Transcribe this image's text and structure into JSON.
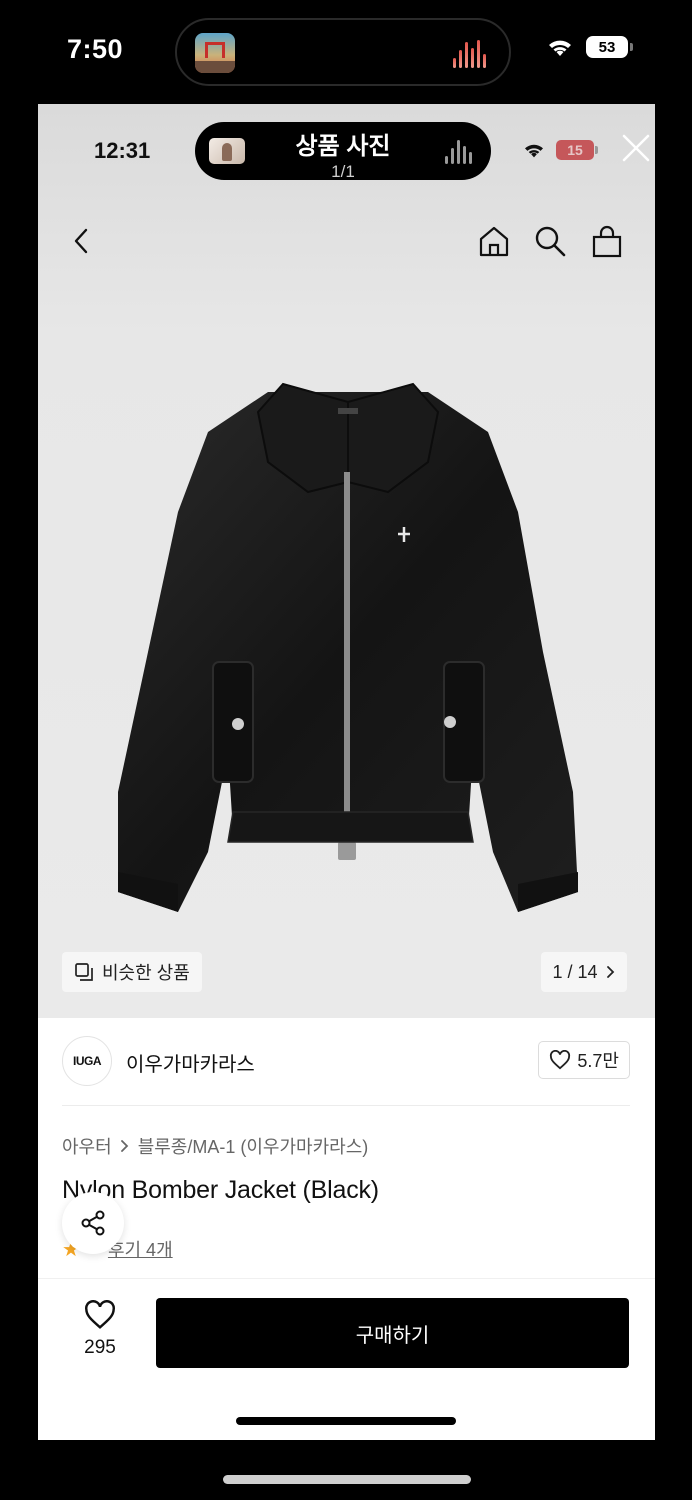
{
  "outer_status": {
    "time": "7:50",
    "battery": "53"
  },
  "inner_status": {
    "time": "12:31",
    "battery": "15"
  },
  "viewer": {
    "title": "상품 사진",
    "count": "1/1"
  },
  "gallery": {
    "similar_label": "비슷한 상품",
    "page_indicator": "1 / 14"
  },
  "brand": {
    "logo_text": "IUGA",
    "name": "이우가마카라스",
    "likes": "5.7만"
  },
  "product": {
    "breadcrumb": [
      "아우터",
      "블루종/MA-1 (이우가마카라스)"
    ],
    "title": "Nylon Bomber Jacket (Black)",
    "review_link": "후기 4개"
  },
  "bottom_bar": {
    "wish_count": "295",
    "buy_label": "구매하기"
  },
  "icons": [
    "back-icon",
    "home-icon",
    "search-icon",
    "bag-icon",
    "close-icon",
    "share-icon",
    "heart-icon",
    "similar-icon",
    "chevron-right-icon",
    "star-icon",
    "wifi-icon"
  ]
}
